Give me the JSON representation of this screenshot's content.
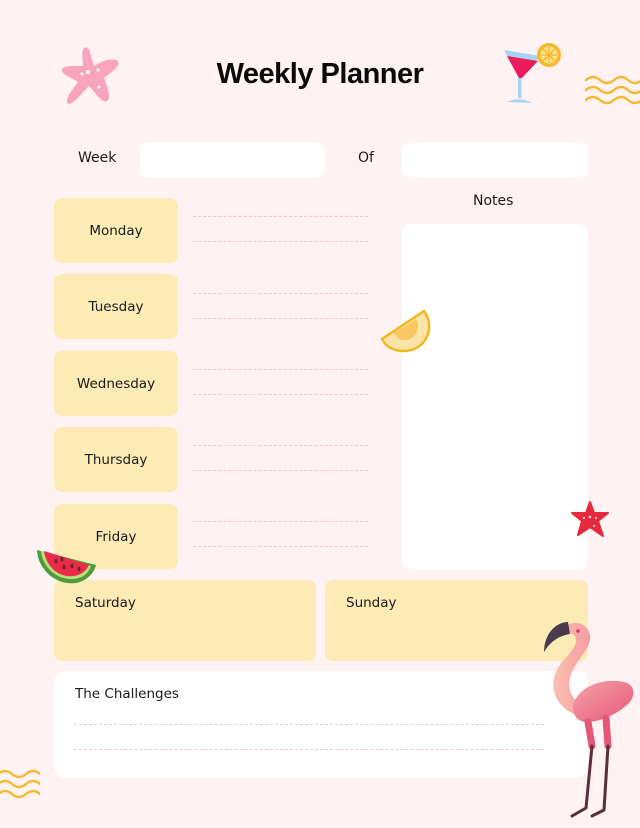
{
  "header": {
    "title": "Weekly Planner"
  },
  "week_row": {
    "week_label": "Week",
    "week_value": "",
    "of_label": "Of",
    "of_value": ""
  },
  "notes": {
    "label": "Notes",
    "value": ""
  },
  "weekdays": [
    {
      "label": "Monday"
    },
    {
      "label": "Tuesday"
    },
    {
      "label": "Wednesday"
    },
    {
      "label": "Thursday"
    },
    {
      "label": "Friday"
    }
  ],
  "weekend": [
    {
      "label": "Saturday"
    },
    {
      "label": "Sunday"
    }
  ],
  "challenges": {
    "label": "The Challenges"
  },
  "decorations": [
    "starfish-pink-icon",
    "cocktail-icon",
    "wave-lines-icon",
    "melon-slice-icon",
    "starfish-red-icon",
    "watermelon-slice-icon",
    "flamingo-icon"
  ],
  "colors": {
    "background": "#fef2f2",
    "day_box": "#fdebb6",
    "dash_line": "#f7c6d0",
    "wave": "#f5b82e"
  }
}
